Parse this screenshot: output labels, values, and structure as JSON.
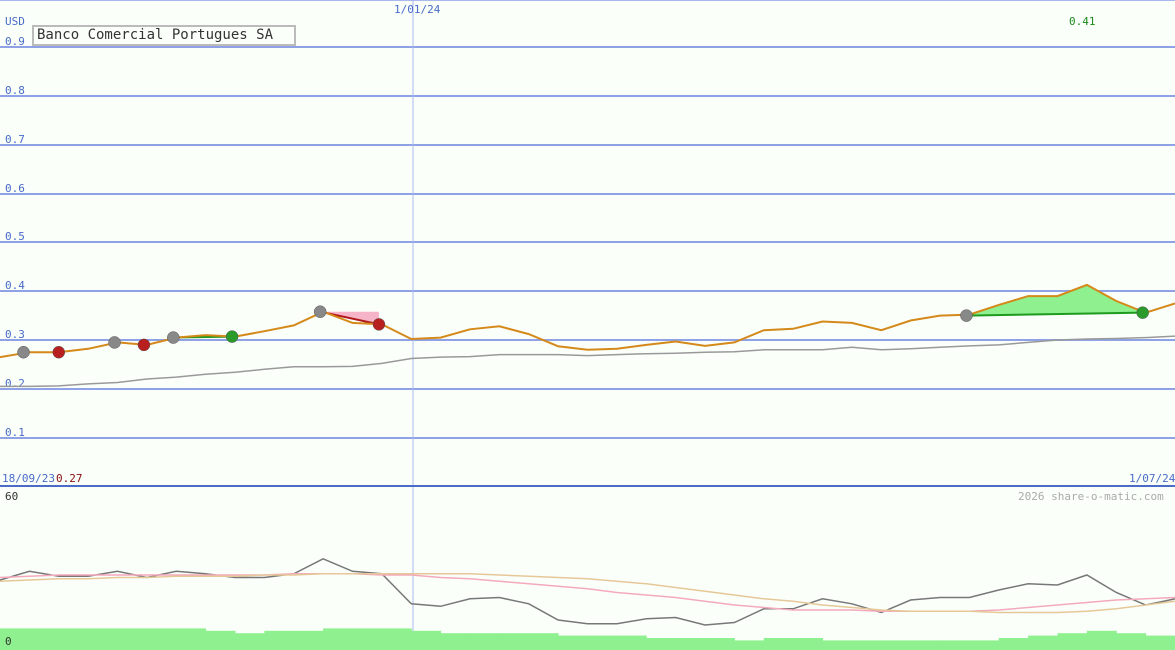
{
  "title": "Banco Comercial Portugues SA",
  "currency": "USD",
  "start_date": "18/09/23",
  "start_value": "0.27",
  "mid_date": "1/01/24",
  "end_date": "1/07/24",
  "high_value": "0.41",
  "copyright": "2026 share-o-matic.com",
  "osc_max": "60",
  "osc_min": "0",
  "chart_data": {
    "type": "line",
    "title": "Banco Comercial Portugues SA",
    "ylabel": "USD",
    "ylim": [
      0.05,
      0.9
    ],
    "yticks": [
      "0.9",
      "0.8",
      "0.7",
      "0.6",
      "0.5",
      "0.4",
      "0.3",
      "0.2",
      "0.1"
    ],
    "x_index_range": [
      0,
      40
    ],
    "xlabels": [
      "18/09/23",
      "1/01/24",
      "1/07/24"
    ],
    "series": [
      {
        "color": "#d4891a",
        "values": [
          0.265,
          0.275,
          0.275,
          0.282,
          0.295,
          0.29,
          0.305,
          0.31,
          0.307,
          0.318,
          0.33,
          0.358,
          0.335,
          0.332,
          0.302,
          0.305,
          0.322,
          0.328,
          0.312,
          0.287,
          0.28,
          0.282,
          0.29,
          0.297,
          0.288,
          0.295,
          0.32,
          0.323,
          0.338,
          0.335,
          0.32,
          0.34,
          0.35,
          0.352,
          0.372,
          0.39,
          0.39,
          0.413,
          0.38,
          0.356,
          0.375
        ]
      },
      {
        "color": "#999999",
        "values": [
          0.205,
          0.205,
          0.206,
          0.21,
          0.213,
          0.22,
          0.224,
          0.23,
          0.234,
          0.24,
          0.245,
          0.245,
          0.246,
          0.252,
          0.262,
          0.265,
          0.266,
          0.27,
          0.27,
          0.27,
          0.268,
          0.27,
          0.272,
          0.273,
          0.275,
          0.276,
          0.28,
          0.28,
          0.28,
          0.285,
          0.28,
          0.282,
          0.285,
          0.288,
          0.29,
          0.295,
          0.3,
          0.302,
          0.303,
          0.305,
          0.308
        ]
      }
    ],
    "signals": [
      {
        "x": 0.8,
        "y": 0.275,
        "kind": "neutral"
      },
      {
        "x": 2.0,
        "y": 0.275,
        "kind": "sell"
      },
      {
        "x": 3.9,
        "y": 0.295,
        "kind": "neutral"
      },
      {
        "x": 4.9,
        "y": 0.29,
        "kind": "sell"
      },
      {
        "x": 5.9,
        "y": 0.305,
        "kind": "neutral"
      },
      {
        "x": 7.9,
        "y": 0.307,
        "kind": "buy"
      },
      {
        "x": 10.9,
        "y": 0.358,
        "kind": "neutral"
      },
      {
        "x": 12.9,
        "y": 0.332,
        "kind": "sell"
      },
      {
        "x": 32.9,
        "y": 0.35,
        "kind": "neutral"
      },
      {
        "x": 38.9,
        "y": 0.356,
        "kind": "buy"
      }
    ],
    "spans": [
      {
        "from": 5.9,
        "to": 7.9,
        "y0": 0.305,
        "y1": 0.307,
        "kind": "gain"
      },
      {
        "from": 10.9,
        "to": 12.9,
        "y0": 0.358,
        "y1": 0.332,
        "kind": "loss"
      },
      {
        "from": 32.9,
        "to": 38.9,
        "y0": 0.35,
        "y1": 0.356,
        "kind": "gain"
      }
    ],
    "oscillator": {
      "ylim": [
        0,
        60
      ],
      "series": [
        {
          "color": "#777777",
          "values": [
            40,
            47,
            43,
            43,
            47,
            42,
            47,
            45,
            42,
            42,
            45,
            57,
            47,
            45,
            21,
            19,
            25,
            26,
            21,
            8,
            5,
            5,
            9,
            10,
            4,
            6,
            17,
            17,
            25,
            21,
            14,
            24,
            26,
            26,
            32,
            37,
            36,
            44,
            30,
            20,
            25
          ]
        },
        {
          "color": "#f4a9bc",
          "values": [
            42,
            43,
            44,
            44,
            44,
            44,
            44,
            44,
            44,
            44,
            45,
            45,
            45,
            44,
            44,
            42,
            41,
            39,
            37,
            35,
            33,
            30,
            28,
            26,
            23,
            20,
            18,
            16,
            16,
            16,
            15,
            15,
            15,
            15,
            16,
            18,
            20,
            22,
            24,
            25,
            26
          ]
        },
        {
          "color": "#e6c898",
          "values": [
            39,
            40,
            41,
            41,
            42,
            42,
            43,
            43,
            43,
            44,
            44,
            45,
            45,
            45,
            45,
            45,
            45,
            44,
            43,
            42,
            41,
            39,
            37,
            34,
            31,
            28,
            25,
            23,
            20,
            18,
            16,
            15,
            15,
            15,
            14,
            14,
            14,
            15,
            17,
            20,
            23
          ]
        }
      ],
      "volume": [
        9,
        9,
        9,
        9,
        9,
        9,
        9,
        8,
        7,
        8,
        8,
        9,
        9,
        9,
        8,
        7,
        7,
        7,
        7,
        6,
        6,
        6,
        5,
        5,
        5,
        4,
        5,
        5,
        4,
        4,
        4,
        4,
        4,
        4,
        5,
        6,
        7,
        8,
        7,
        6,
        7
      ]
    }
  }
}
